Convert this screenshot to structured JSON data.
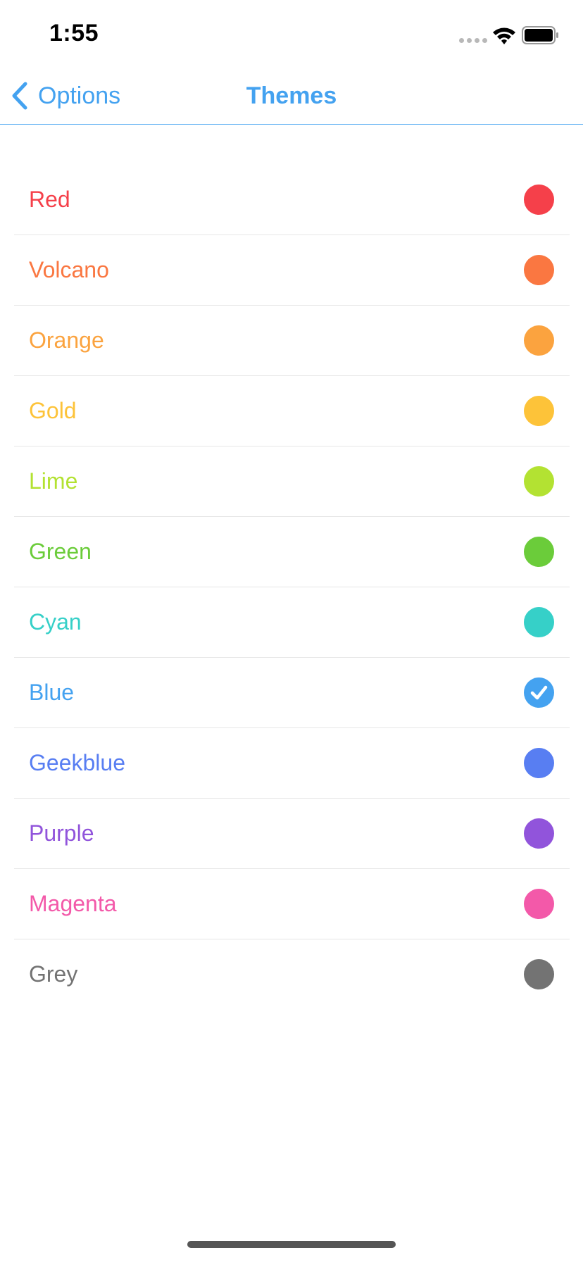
{
  "status_bar": {
    "time": "1:55"
  },
  "nav": {
    "back_label": "Options",
    "title": "Themes",
    "accent_color": "#44a2f0"
  },
  "themes": [
    {
      "name": "Red",
      "color": "#f5404a",
      "selected": false
    },
    {
      "name": "Volcano",
      "color": "#fa7741",
      "selected": false
    },
    {
      "name": "Orange",
      "color": "#fba33f",
      "selected": false
    },
    {
      "name": "Gold",
      "color": "#fdc339",
      "selected": false
    },
    {
      "name": "Lime",
      "color": "#b3e232",
      "selected": false
    },
    {
      "name": "Green",
      "color": "#6bcc3a",
      "selected": false
    },
    {
      "name": "Cyan",
      "color": "#36d0c8",
      "selected": false
    },
    {
      "name": "Blue",
      "color": "#44a2f0",
      "selected": true
    },
    {
      "name": "Geekblue",
      "color": "#587ef2",
      "selected": false
    },
    {
      "name": "Purple",
      "color": "#9154db",
      "selected": false
    },
    {
      "name": "Magenta",
      "color": "#f359a9",
      "selected": false
    },
    {
      "name": "Grey",
      "color": "#737373",
      "selected": false
    }
  ],
  "icons": {
    "back": "chevron-left-icon",
    "selected": "checkmark-icon",
    "wifi": "wifi-icon",
    "battery": "battery-icon",
    "signal": "cellular-signal-icon"
  }
}
